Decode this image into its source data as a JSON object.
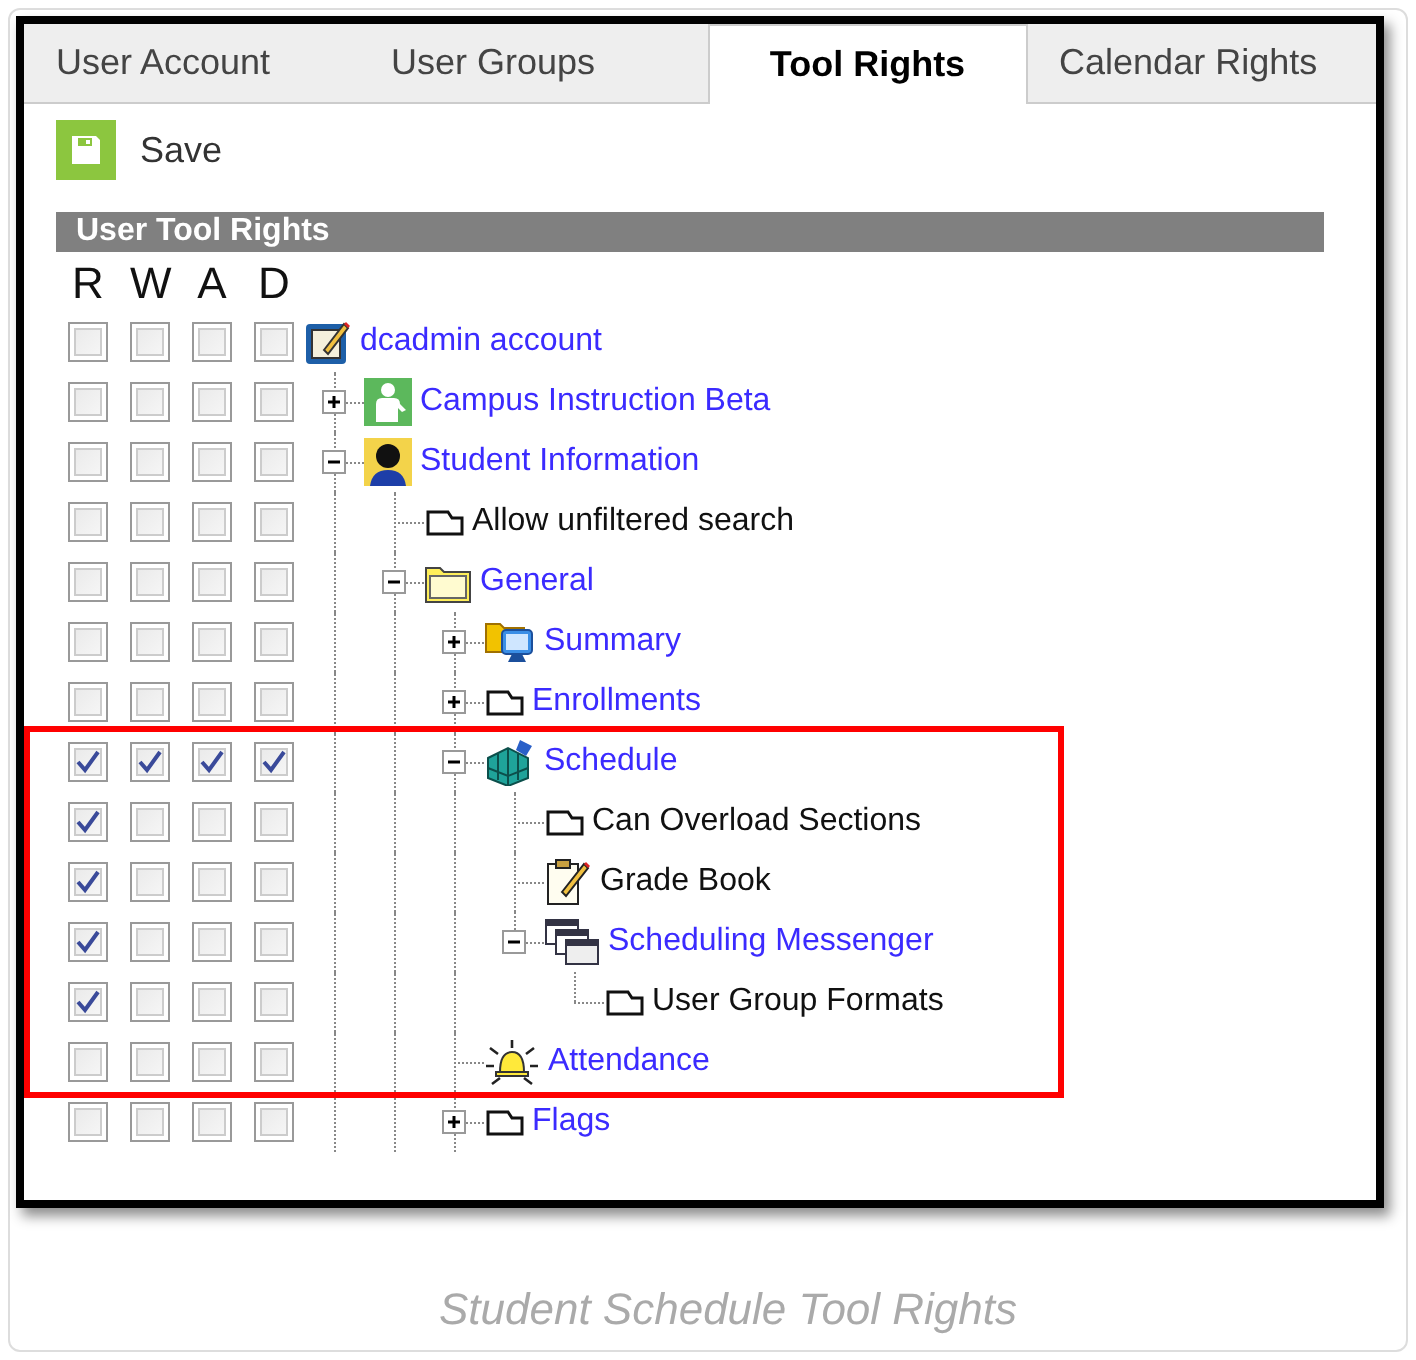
{
  "tabs": [
    {
      "label": "User Account",
      "selected": false
    },
    {
      "label": "User Groups",
      "selected": false
    },
    {
      "label": "Tool Rights",
      "selected": true
    },
    {
      "label": "Calendar Rights",
      "selected": false
    }
  ],
  "save_button": {
    "label": "Save"
  },
  "section_title": "User Tool Rights",
  "columns": [
    "R",
    "W",
    "A",
    "D"
  ],
  "tree": [
    {
      "label": "dcadmin account",
      "kind": "account",
      "link": true,
      "checks": [
        false,
        false,
        false,
        false
      ],
      "children": [
        {
          "label": "Campus Instruction Beta",
          "kind": "person",
          "link": true,
          "expanded": false,
          "checks": [
            false,
            false,
            false,
            false
          ],
          "continued": false
        },
        {
          "label": "Student Information",
          "kind": "student",
          "link": true,
          "expanded": true,
          "checks": [
            false,
            false,
            false,
            false
          ],
          "continued": true,
          "children": [
            {
              "label": "Allow unfiltered search",
              "kind": "page",
              "link": false,
              "checks": [
                false,
                false,
                false,
                false
              ],
              "continued": false
            },
            {
              "label": "General",
              "kind": "folder",
              "link": true,
              "expanded": true,
              "checks": [
                false,
                false,
                false,
                false
              ],
              "continued": true,
              "children": [
                {
                  "label": "Summary",
                  "kind": "monitor",
                  "link": true,
                  "expanded": false,
                  "checks": [
                    false,
                    false,
                    false,
                    false
                  ],
                  "continued": false
                },
                {
                  "label": "Enrollments",
                  "kind": "page",
                  "link": true,
                  "expanded": false,
                  "checks": [
                    false,
                    false,
                    false,
                    false
                  ],
                  "continued": false
                },
                {
                  "label": "Schedule",
                  "kind": "schedule",
                  "link": true,
                  "expanded": true,
                  "checks": [
                    true,
                    true,
                    true,
                    true
                  ],
                  "continued": false,
                  "highlight_start": true,
                  "children": [
                    {
                      "label": "Can Overload Sections",
                      "kind": "page",
                      "link": false,
                      "checks": [
                        true,
                        false,
                        false,
                        false
                      ],
                      "continued": false
                    },
                    {
                      "label": "Grade Book",
                      "kind": "notepad",
                      "link": false,
                      "checks": [
                        true,
                        false,
                        false,
                        false
                      ],
                      "continued": false
                    },
                    {
                      "label": "Scheduling Messenger",
                      "kind": "windows",
                      "link": true,
                      "expanded": true,
                      "checks": [
                        true,
                        false,
                        false,
                        false
                      ],
                      "continued": false,
                      "children": [
                        {
                          "label": "User Group Formats",
                          "kind": "page",
                          "link": false,
                          "checks": [
                            true,
                            false,
                            false,
                            false
                          ],
                          "continued": false
                        }
                      ]
                    }
                  ]
                },
                {
                  "label": "Attendance",
                  "kind": "bell",
                  "link": true,
                  "checks": [
                    false,
                    false,
                    false,
                    false
                  ],
                  "continued": false,
                  "highlight_end": true
                },
                {
                  "label": "Flags",
                  "kind": "page",
                  "link": true,
                  "expanded": false,
                  "checks": [
                    false,
                    false,
                    false,
                    false
                  ],
                  "continued": true
                }
              ]
            }
          ]
        }
      ]
    }
  ],
  "caption": "Student Schedule Tool Rights"
}
